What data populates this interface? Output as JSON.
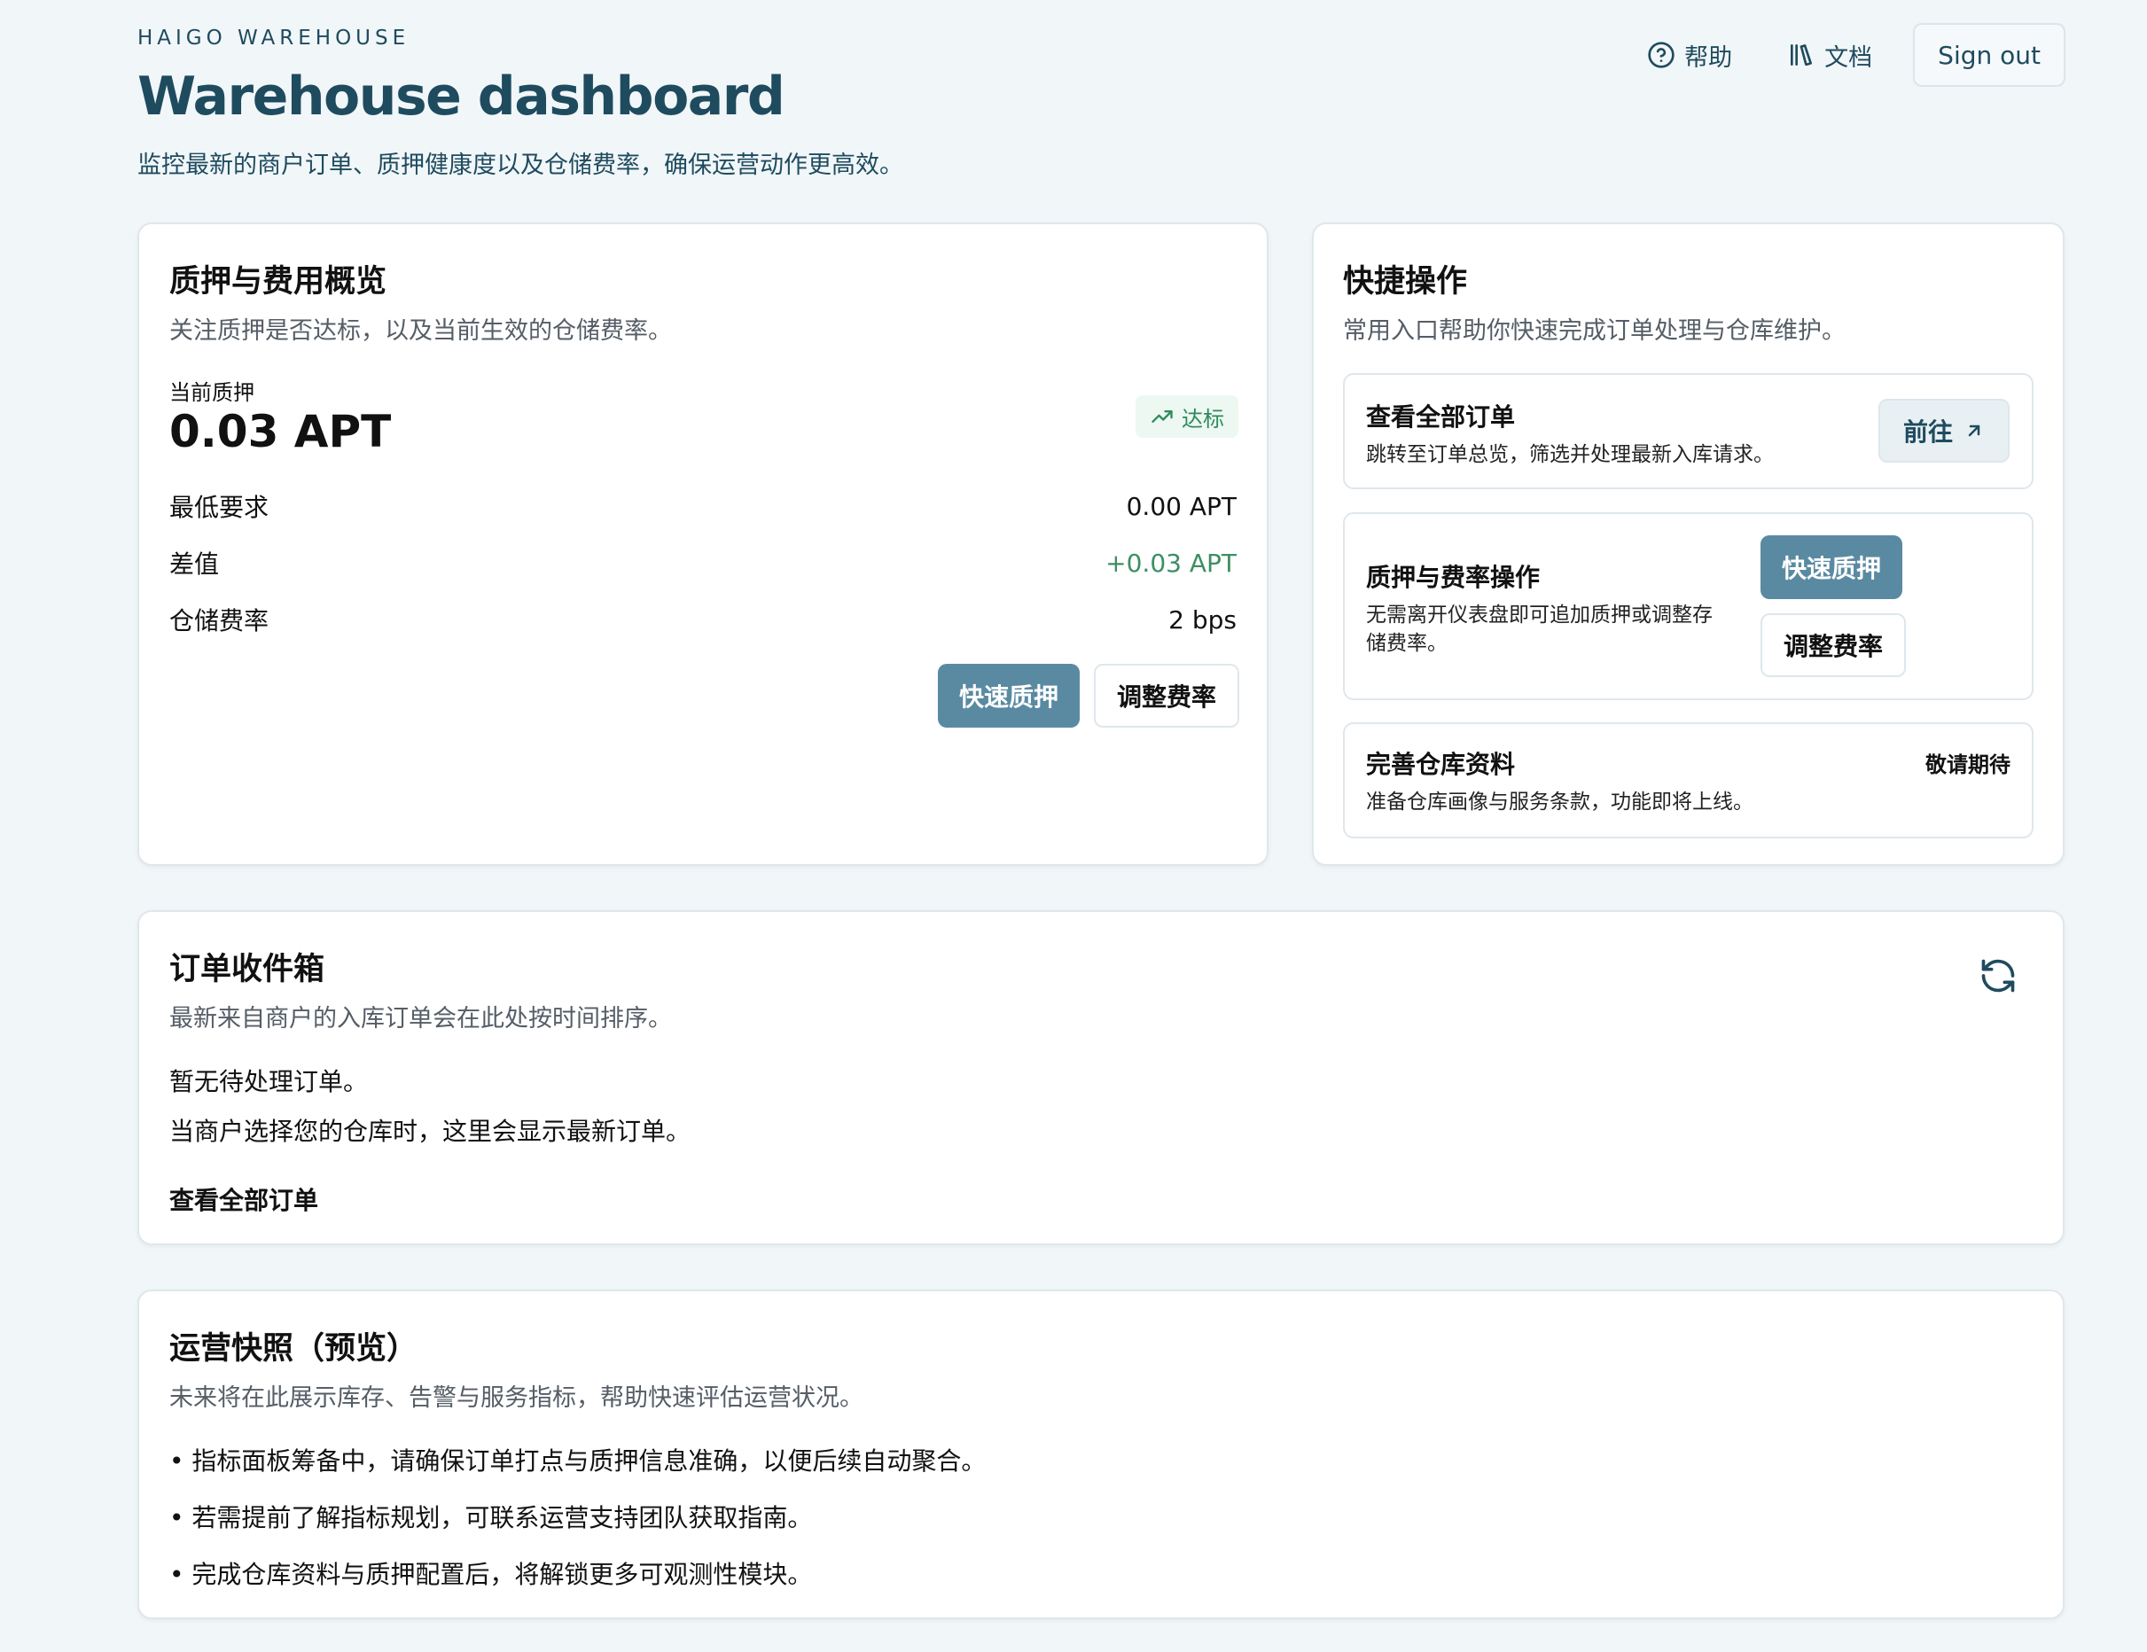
{
  "header": {
    "eyebrow": "HAIGO WAREHOUSE",
    "title": "Warehouse dashboard",
    "subtitle": "监控最新的商户订单、质押健康度以及仓储费率，确保运营动作更高效。",
    "help_label": "帮助",
    "docs_label": "文档",
    "signout_label": "Sign out"
  },
  "collateral": {
    "title": "质押与费用概览",
    "description": "关注质押是否达标，以及当前生效的仓储费率。",
    "current_label": "当前质押",
    "current_value": "0.03 APT",
    "status": "达标",
    "rows": [
      {
        "label": "最低要求",
        "value": "0.00 APT"
      },
      {
        "label": "差值",
        "value": "+0.03 APT"
      },
      {
        "label": "仓储费率",
        "value": "2 bps"
      }
    ],
    "primary_button": "快速质押",
    "secondary_button": "调整费率"
  },
  "quick_actions": {
    "title": "快捷操作",
    "description": "常用入口帮助你快速完成订单处理与仓库维护。",
    "items": [
      {
        "title": "查看全部订单",
        "description": "跳转至订单总览，筛选并处理最新入库请求。",
        "button": "前往"
      },
      {
        "title": "质押与费率操作",
        "description_line1": "无需离开仪表盘即可追加质押或调整存",
        "description_line2": "储费率。",
        "primary_button": "快速质押",
        "secondary_button": "调整费率"
      },
      {
        "title": "完善仓库资料",
        "description": "准备仓库画像与服务条款，功能即将上线。",
        "badge": "敬请期待"
      }
    ]
  },
  "inbox": {
    "title": "订单收件箱",
    "description": "最新来自商户的入库订单会在此处按时间排序。",
    "empty_title": "暂无待处理订单。",
    "empty_hint": "当商户选择您的仓库时，这里会显示最新订单。",
    "view_all": "查看全部订单"
  },
  "snapshot": {
    "title": "运营快照（预览）",
    "description": "未来将在此展示库存、告警与服务指标，帮助快速评估运营状况。",
    "bullets": [
      "• 指标面板筹备中，请确保订单打点与质押信息准确，以便后续自动聚合。",
      "• 若需提前了解指标规划，可联系运营支持团队获取指南。",
      "• 完成仓库资料与质押配置后，将解锁更多可观测性模块。"
    ]
  },
  "colors": {
    "background": "#f1f6f8",
    "brand_text": "#1f4b5f",
    "primary_button": "#5a8aa2",
    "positive": "#3d8f63"
  },
  "icons": [
    "help-circle-icon",
    "library-icon",
    "trending-up-icon",
    "arrow-up-right-icon",
    "refresh-icon"
  ]
}
